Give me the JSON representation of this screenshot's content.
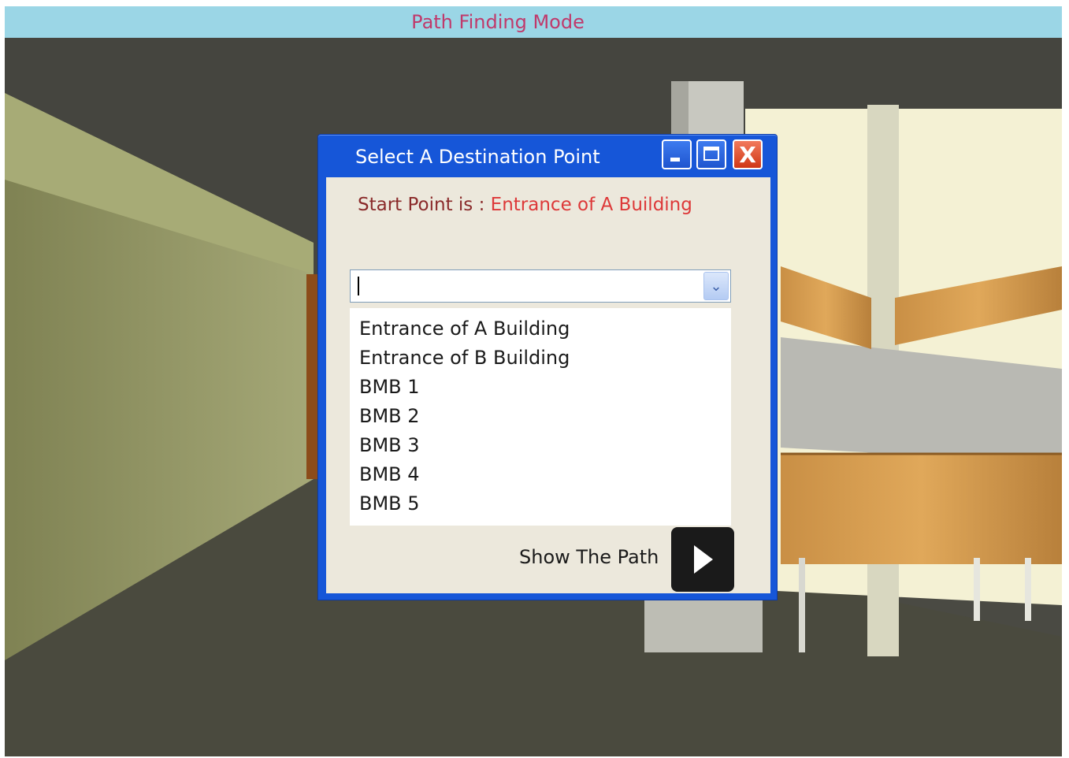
{
  "header": {
    "mode_title": "Path Finding Mode"
  },
  "dialog": {
    "title": "Select A Destination Point",
    "window_buttons": [
      "minimize-icon",
      "maximize-icon",
      "close-icon"
    ],
    "close_glyph": "X",
    "start_label": "Start Point is :",
    "start_value": "Entrance of A Building",
    "combo": {
      "value": "",
      "arrow_glyph": "⌄"
    },
    "options": [
      "Entrance of A Building",
      "Entrance of B Building",
      "BMB 1",
      "BMB 2",
      "BMB 3",
      "BMB 4",
      "BMB 5"
    ],
    "show_path_label": "Show The Path",
    "play_icon": "play-icon"
  },
  "colors": {
    "header_bg": "#9bd6e6",
    "header_text": "#c0396b",
    "dialog_frame": "#1656d8",
    "dialog_body": "#ece8dc",
    "start_label": "#8a2a2a",
    "start_value": "#dd3838",
    "close_button": "#d03716"
  }
}
